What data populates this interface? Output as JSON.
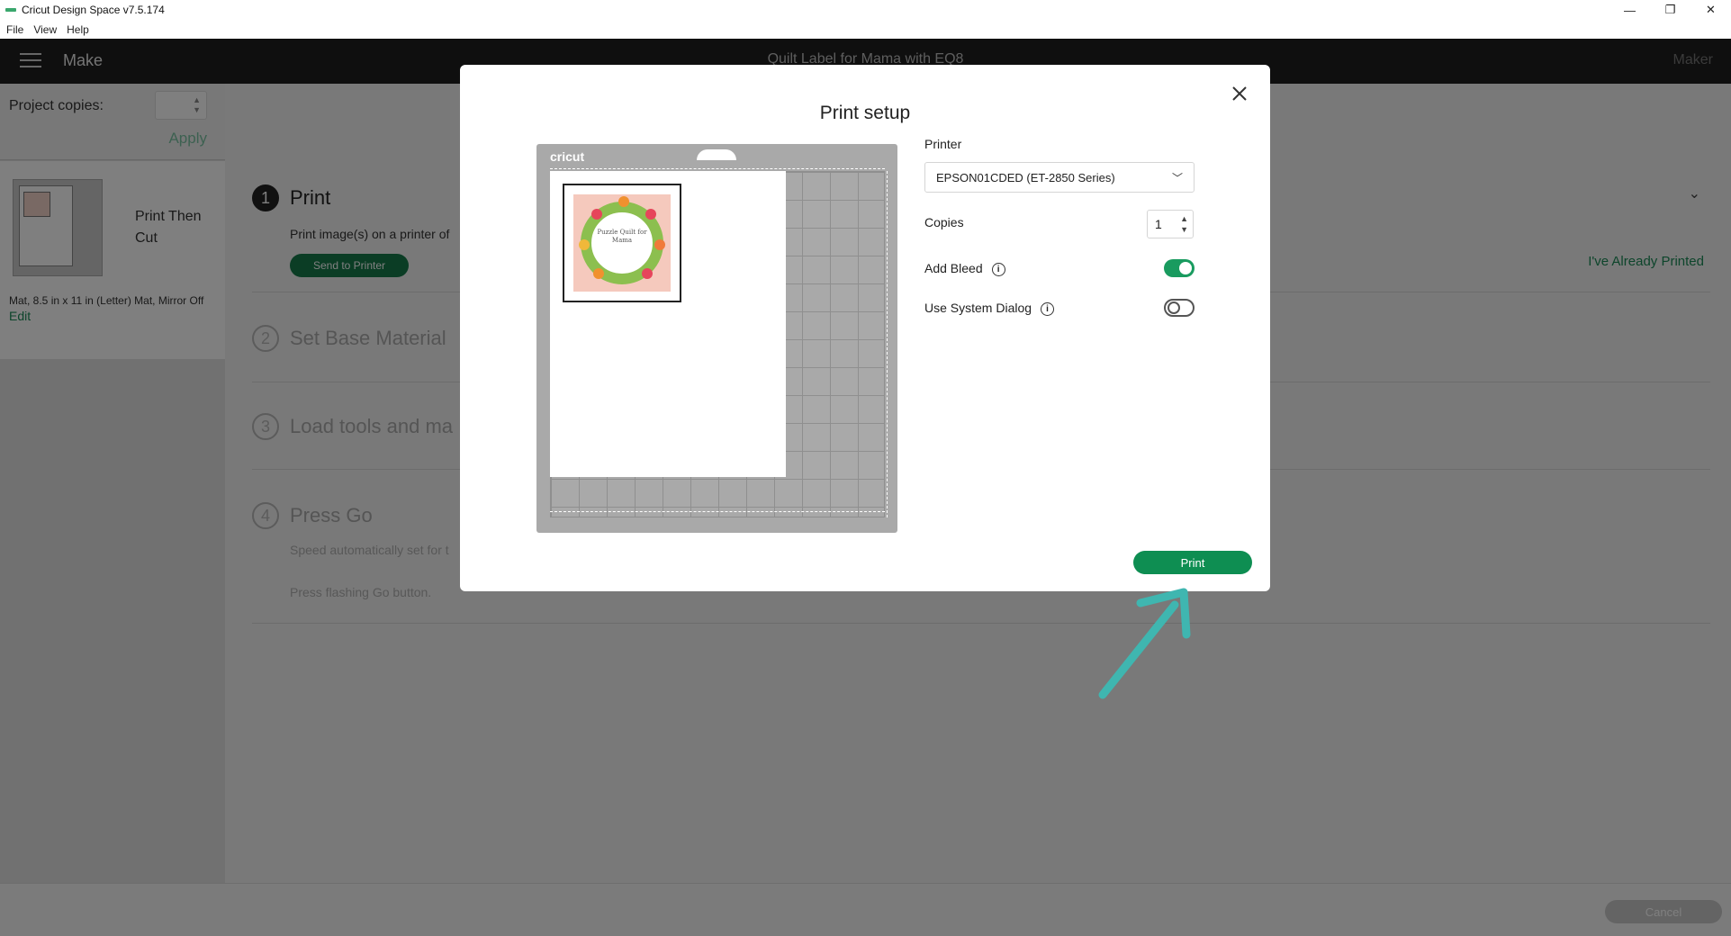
{
  "window": {
    "title": "Cricut Design Space  v7.5.174",
    "controls": {
      "minimize": "—",
      "restore": "❐",
      "close": "✕"
    }
  },
  "menu": [
    "File",
    "View",
    "Help"
  ],
  "header": {
    "mode": "Make",
    "project_title": "Quilt Label for Mama with EQ8",
    "machine": "Maker"
  },
  "sidebar": {
    "copies_label": "Project copies:",
    "copies_value": "",
    "apply_label": "Apply",
    "mat_name": "Print Then Cut",
    "mat_desc": "Mat, 8.5 in x 11 in (Letter) Mat, Mirror Off",
    "edit_label": "Edit"
  },
  "steps": [
    {
      "num": "1",
      "title": "Print",
      "desc": "Print image(s) on a printer of"
    },
    {
      "num": "2",
      "title": "Set Base Material"
    },
    {
      "num": "3",
      "title": "Load tools and ma"
    },
    {
      "num": "4",
      "title": "Press Go",
      "desc1": "Speed automatically set for t",
      "desc2": "Press flashing Go button."
    }
  ],
  "main": {
    "send_to_printer": "Send to Printer",
    "already_printed": "I've Already Printed"
  },
  "footer": {
    "cancel_label": "Cancel"
  },
  "modal": {
    "title": "Print setup",
    "mat_brand": "cricut",
    "label_text": "Puzzle Quilt for Mama",
    "printer_label": "Printer",
    "printer_value": "EPSON01CDED (ET-2850 Series)",
    "copies_label": "Copies",
    "copies_value": "1",
    "add_bleed_label": "Add Bleed",
    "add_bleed_on": true,
    "system_dialog_label": "Use System Dialog",
    "system_dialog_on": false,
    "print_label": "Print"
  },
  "colors": {
    "accent_green": "#0e8e52",
    "annotation_arrow": "#3fb6b0"
  },
  "icons": {
    "menu": "hamburger-icon",
    "close": "close-icon",
    "info": "info-icon",
    "dropdown": "chevron-down-icon"
  }
}
